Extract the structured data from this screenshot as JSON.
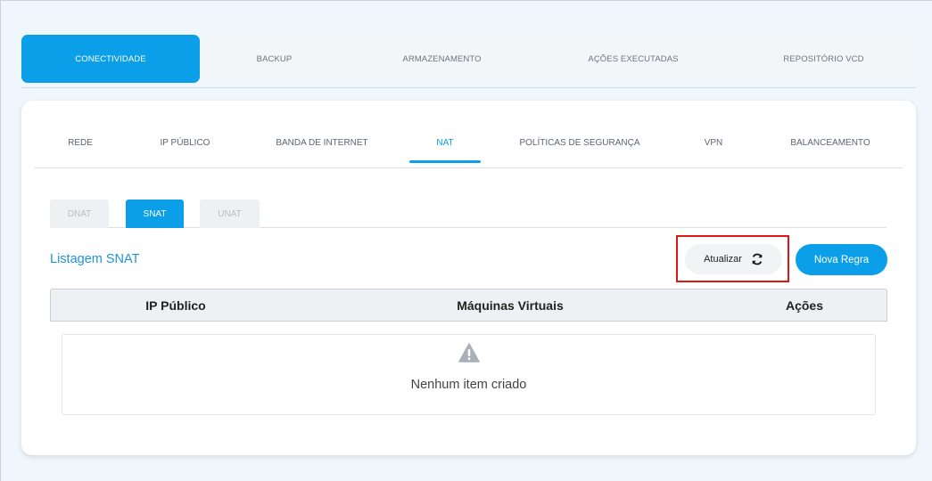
{
  "top_tabs": {
    "items": [
      {
        "label": "CONECTIVIDADE",
        "active": true
      },
      {
        "label": "BACKUP",
        "active": false
      },
      {
        "label": "ARMAZENAMENTO",
        "active": false
      },
      {
        "label": "AÇÕES EXECUTADAS",
        "active": false
      },
      {
        "label": "REPOSITÓRIO VCD",
        "active": false
      }
    ]
  },
  "sub_tabs": {
    "items": [
      {
        "label": "REDE",
        "active": false
      },
      {
        "label": "IP PÚBLICO",
        "active": false
      },
      {
        "label": "BANDA DE INTERNET",
        "active": false
      },
      {
        "label": "NAT",
        "active": true
      },
      {
        "label": "POLÍTICAS DE SEGURANÇA",
        "active": false
      },
      {
        "label": "VPN",
        "active": false
      },
      {
        "label": "BALANCEAMENTO",
        "active": false
      }
    ]
  },
  "nat_tabs": {
    "items": [
      {
        "label": "DNAT",
        "active": false
      },
      {
        "label": "SNAT",
        "active": true
      },
      {
        "label": "UNAT",
        "active": false
      }
    ]
  },
  "list": {
    "title": "Listagem SNAT",
    "refresh_label": "Atualizar",
    "new_rule_label": "Nova Regra"
  },
  "table": {
    "columns": [
      "IP Público",
      "Máquinas Virtuais",
      "Ações"
    ],
    "empty_message": "Nenhum item criado"
  },
  "colors": {
    "accent": "#0a9fe8",
    "highlight_border": "#e01515",
    "warning_icon": "#a9b0b7"
  },
  "icons": {
    "refresh": "refresh-icon",
    "empty": "warning-triangle-icon"
  }
}
